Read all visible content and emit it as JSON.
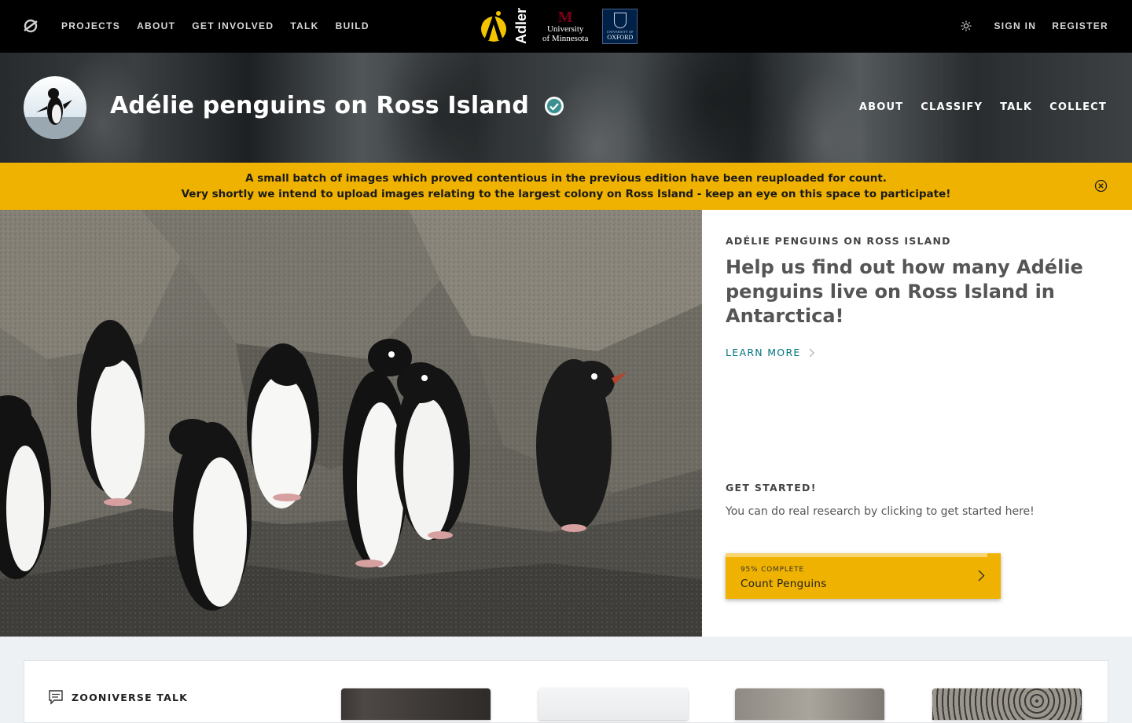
{
  "topnav": {
    "links": [
      "PROJECTS",
      "ABOUT",
      "GET INVOLVED",
      "TALK",
      "BUILD"
    ],
    "sign_in": "SIGN IN",
    "register": "REGISTER"
  },
  "partner_logos": {
    "adler": "Adler",
    "umn_line1": "University",
    "umn_line2": "of Minnesota",
    "oxford_small": "UNIVERSITY OF",
    "oxford_big": "OXFORD"
  },
  "project": {
    "title": "Adélie penguins on Ross Island",
    "nav": [
      "ABOUT",
      "CLASSIFY",
      "TALK",
      "COLLECT"
    ]
  },
  "announcement": {
    "line1": "A small batch of images which proved contentious in the previous edition have been reuploaded for count.",
    "line2": "Very shortly we intend to upload images relating to the largest colony on Ross Island - keep an eye on this space to participate!"
  },
  "intro": {
    "kicker": "ADÉLIE PENGUINS ON ROSS ISLAND",
    "description": "Help us find out how many Adélie penguins live on Ross Island in Antarctica!",
    "learn_more": "LEARN MORE",
    "get_started_heading": "GET STARTED!",
    "get_started_text": "You can do real research by clicking to get started here!"
  },
  "workflow": {
    "completeness_label": "95% COMPLETE",
    "completeness": 0.95,
    "name": "Count Penguins"
  },
  "talk": {
    "heading": "ZOONIVERSE TALK"
  },
  "colors": {
    "accent": "#f0b200",
    "link": "#00747d",
    "nav_bg": "#000000"
  }
}
